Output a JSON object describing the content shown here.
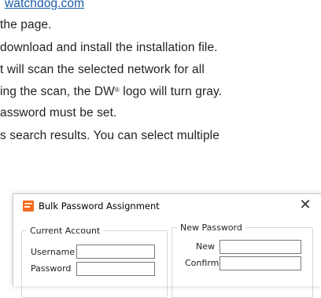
{
  "doc": {
    "line1_link": "watchdog.com",
    "line2": "the page.",
    "line3": "download and install the installation file.",
    "line4": "t will scan the selected network for all",
    "line5_a": "ing the scan, the DW",
    "line5_sup": "®",
    "line5_b": " logo will turn gray.",
    "line6": "assword must be set.",
    "line7": "s search results. You can select multiple"
  },
  "dialog": {
    "title": "Bulk Password Assignment",
    "close_glyph": "✕",
    "icon": "app-icon",
    "current_account": {
      "legend": "Current Account",
      "username_label": "Username",
      "username_value": "",
      "password_label": "Password",
      "password_value": ""
    },
    "new_password": {
      "legend": "New Password",
      "new_label": "New",
      "new_value": "",
      "confirm_label": "Confirm",
      "confirm_value": ""
    }
  },
  "colors": {
    "link": "#1a5aa6",
    "text": "#231f20",
    "icon_orange": "#f26b21"
  }
}
